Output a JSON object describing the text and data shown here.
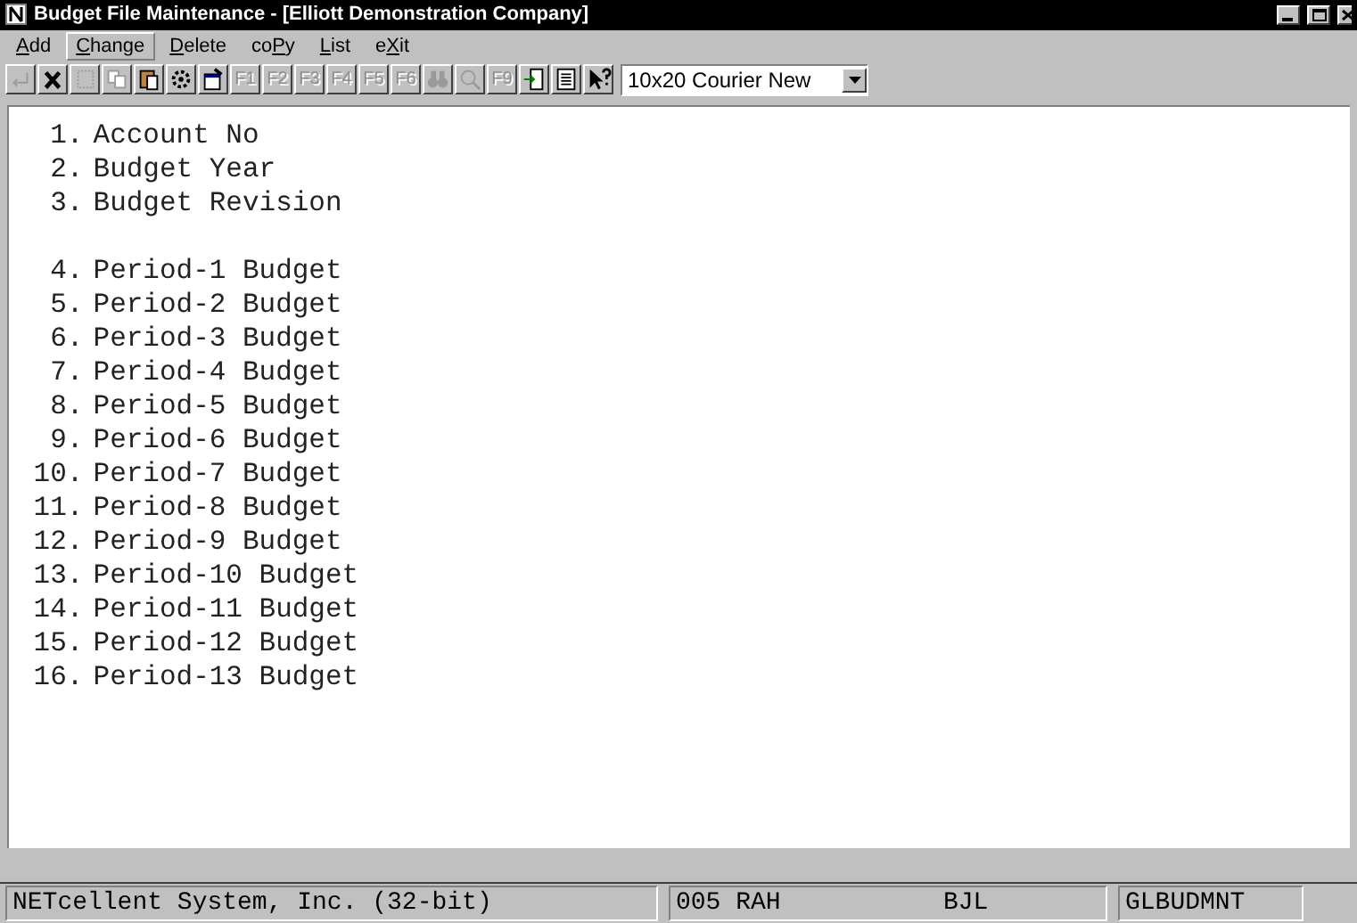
{
  "window": {
    "title": "Budget File Maintenance - [Elliott Demonstration Company]"
  },
  "menu": [
    {
      "key": "A",
      "after": "dd",
      "selected": false
    },
    {
      "key": "C",
      "after": "hange",
      "selected": true
    },
    {
      "key": "D",
      "after": "elete",
      "selected": false
    },
    {
      "before": "co",
      "key": "P",
      "after": "y",
      "selected": false
    },
    {
      "key": "L",
      "after": "ist",
      "selected": false
    },
    {
      "before": "e",
      "key": "X",
      "after": "it",
      "selected": false
    }
  ],
  "toolbar": [
    {
      "kind": "enter",
      "disabled": true
    },
    {
      "kind": "cancel",
      "disabled": false
    },
    {
      "kind": "blank",
      "disabled": true
    },
    {
      "kind": "copy",
      "disabled": true
    },
    {
      "kind": "paste",
      "disabled": false
    },
    {
      "kind": "gear",
      "disabled": false
    },
    {
      "kind": "props",
      "disabled": false
    },
    {
      "kind": "fkey",
      "label": "F1",
      "disabled": true
    },
    {
      "kind": "fkey",
      "label": "F2",
      "disabled": true
    },
    {
      "kind": "fkey",
      "label": "F3",
      "disabled": true
    },
    {
      "kind": "fkey",
      "label": "F4",
      "disabled": true
    },
    {
      "kind": "fkey",
      "label": "F5",
      "disabled": true
    },
    {
      "kind": "fkey",
      "label": "F6",
      "disabled": true
    },
    {
      "kind": "binoculars",
      "disabled": true
    },
    {
      "kind": "magnifier",
      "disabled": true
    },
    {
      "kind": "fkey",
      "label": "F9",
      "disabled": true
    },
    {
      "kind": "exit",
      "disabled": false
    },
    {
      "kind": "notepad",
      "disabled": false
    },
    {
      "kind": "help",
      "disabled": false
    }
  ],
  "font_select": {
    "value": "10x20 Courier New"
  },
  "header_fields": [
    {
      "number": "1.",
      "label": "Account No"
    },
    {
      "number": "2.",
      "label": "Budget Year"
    },
    {
      "number": "3.",
      "label": "Budget Revision"
    }
  ],
  "budget_fields": [
    {
      "number": "4.",
      "label": "Period-1 Budget"
    },
    {
      "number": "5.",
      "label": "Period-2 Budget"
    },
    {
      "number": "6.",
      "label": "Period-3 Budget"
    },
    {
      "number": "7.",
      "label": "Period-4 Budget"
    },
    {
      "number": "8.",
      "label": "Period-5 Budget"
    },
    {
      "number": "9.",
      "label": "Period-6 Budget"
    },
    {
      "number": "10.",
      "label": "Period-7 Budget"
    },
    {
      "number": "11.",
      "label": "Period-8 Budget"
    },
    {
      "number": "12.",
      "label": "Period-9 Budget"
    },
    {
      "number": "13.",
      "label": "Period-10 Budget"
    },
    {
      "number": "14.",
      "label": "Period-11 Budget"
    },
    {
      "number": "15.",
      "label": "Period-12 Budget"
    },
    {
      "number": "16.",
      "label": "Period-13 Budget"
    }
  ],
  "status_bar": {
    "company": "NETcellent System, Inc. (32-bit)",
    "terminal": "005 RAH",
    "user": "BJL",
    "program": "GLBUDMNT"
  }
}
